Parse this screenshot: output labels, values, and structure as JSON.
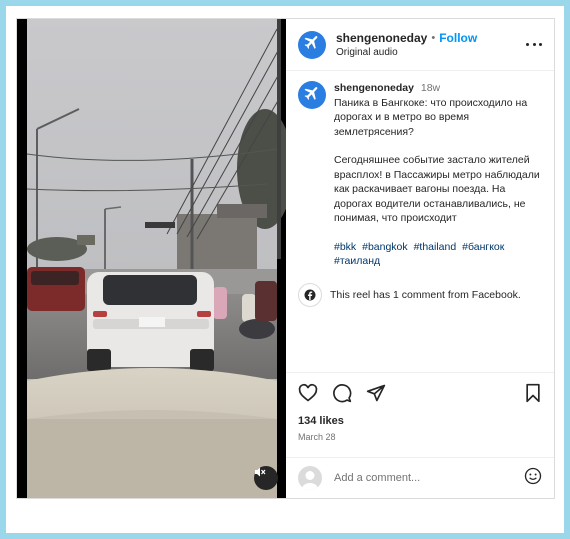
{
  "post": {
    "username": "shengenoneday",
    "follow_label": "Follow",
    "separator": "•",
    "audio_label": "Original audio",
    "caption": {
      "username": "shengenoneday",
      "time": "18w",
      "text_1": "Паника в Бангкоке: что происходило на дорогах и в метро во время землетрясения?",
      "text_2": "Сегодняшнее событие застало жителей врасплох! в Пассажиры метро наблюдали как раскачивает вагоны поезда. На дорогах водители останавливались, не понимая, что происходит",
      "hashtags": [
        "#bkk",
        "#bangkok",
        "#thailand",
        "#бангкок",
        "#таиланд"
      ]
    },
    "facebook_note": "This reel has 1 comment from Facebook.",
    "likes": "134 likes",
    "date": "March 28",
    "comment_placeholder": "Add a comment..."
  },
  "colors": {
    "accent": "#0095f6",
    "hashtag": "#00376b",
    "avatar": "#2a7de1",
    "frame": "#9ad7ea"
  },
  "icons": {
    "avatar": "airplane-icon",
    "more": "more-options-icon",
    "mute": "muted-speaker-icon",
    "like": "heart-icon",
    "comment": "comment-bubble-icon",
    "share": "paper-plane-icon",
    "save": "bookmark-icon",
    "facebook": "facebook-icon",
    "emoji": "emoji-icon"
  }
}
